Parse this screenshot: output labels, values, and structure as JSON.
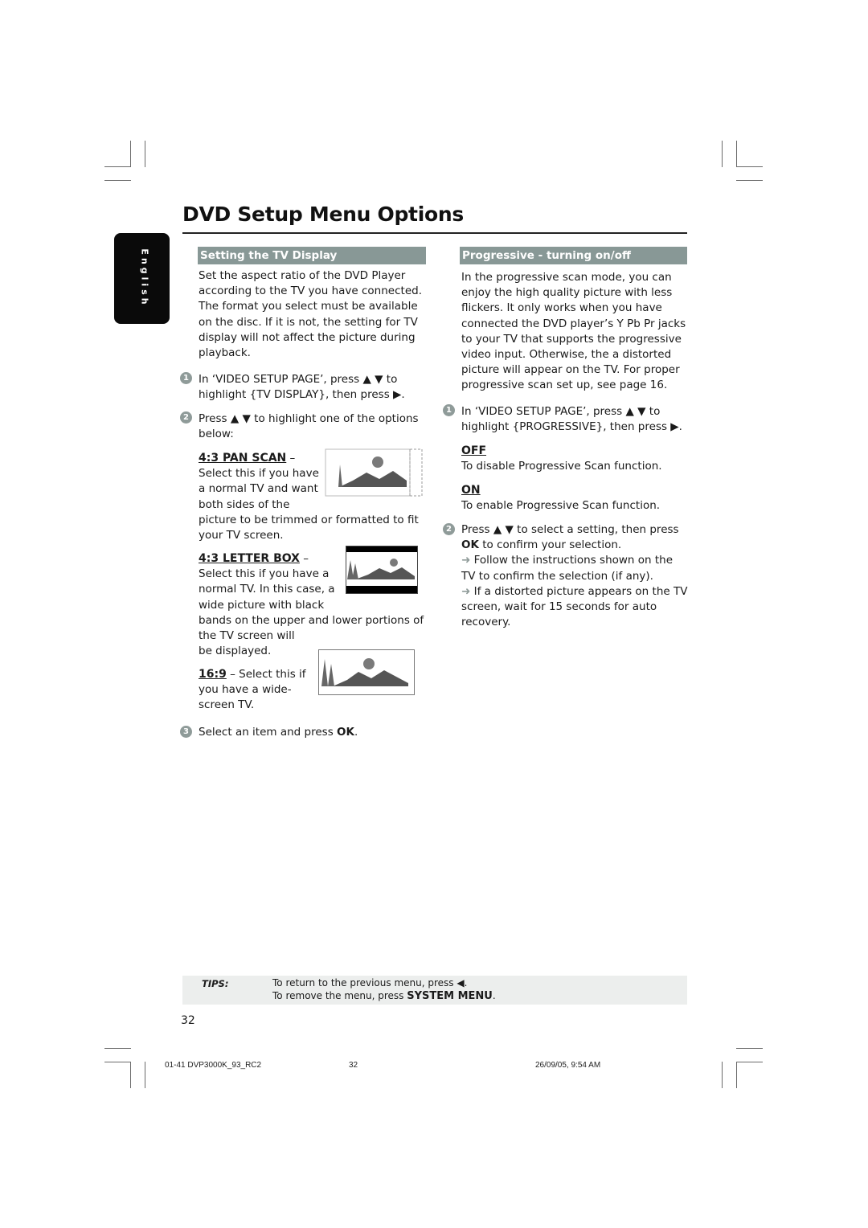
{
  "page": {
    "title": "DVD Setup Menu Options",
    "language_tab": "English",
    "page_number": "32"
  },
  "left_section": {
    "heading": "Setting the TV Display",
    "intro_lines": [
      "Set the aspect ratio of the DVD Player",
      "according to the TV you have connected.",
      "The format you select must be available",
      "on the disc.  If it is not, the setting for TV",
      "display will not affect the picture during",
      "playback."
    ],
    "steps": [
      {
        "number": "1",
        "lines": [
          "In ‘VIDEO SETUP PAGE’, press ▲ ▼ to",
          "highlight {TV DISPLAY}, then press ▶."
        ]
      },
      {
        "number": "2",
        "lines": [
          "Press ▲ ▼ to highlight one of the options",
          "below:"
        ]
      },
      {
        "number": "3",
        "text_before": "Select an item and press ",
        "bold": "OK",
        "text_after": "."
      }
    ],
    "options": [
      {
        "name": "4:3 PAN SCAN",
        "dash": " –",
        "lines": [
          "Select this if you have",
          "a normal TV and want",
          "both sides of the",
          "picture to be trimmed or formatted to fit",
          "your TV screen."
        ],
        "image": "pan-scan-illustration"
      },
      {
        "name": "4:3 LETTER BOX",
        "dash": " –",
        "lines": [
          "Select this if you have a",
          "normal TV. In this case, a",
          "wide picture with black",
          "bands on the upper and lower portions of",
          "the TV screen will",
          "be displayed."
        ],
        "image": "letterbox-illustration"
      },
      {
        "name": "16:9",
        "dash": " – Select this if",
        "lines": [
          "you have a wide-",
          "screen TV."
        ],
        "image": "widescreen-illustration"
      }
    ]
  },
  "right_section": {
    "heading": "Progressive - turning on/off",
    "intro_lines": [
      "In the progressive scan mode, you can",
      "enjoy the high quality picture with less",
      "flickers.  It only works when you have",
      "connected the DVD player’s Y Pb Pr jacks",
      "to your TV that supports the progressive",
      "video input.  Otherwise, the a distorted",
      "picture will appear on the TV.  For proper",
      "progressive scan set up, see page 16."
    ],
    "step1": {
      "number": "1",
      "lines": [
        "In ‘VIDEO SETUP PAGE’, press ▲ ▼ to",
        "highlight {PROGRESSIVE}, then press ▶."
      ]
    },
    "settings": [
      {
        "name": "OFF",
        "description": "To disable Progressive Scan function."
      },
      {
        "name": "ON",
        "description": "To enable Progressive Scan function."
      }
    ],
    "step2": {
      "number": "2",
      "line1": "Press ▲ ▼ to select a setting, then press",
      "line2_bold": "OK",
      "line2_rest": " to confirm your selection.",
      "notes": [
        {
          "arrow": "➜",
          "lines": [
            " Follow the instructions shown on the",
            "TV to confirm the selection (if any)."
          ]
        },
        {
          "arrow": "➜",
          "lines": [
            " If a distorted picture appears on the TV",
            "screen, wait for 15 seconds for auto",
            "recovery."
          ]
        }
      ]
    }
  },
  "tips": {
    "label": "TIPS:",
    "line1": "To return to the previous menu, press ◀.",
    "line2_prefix": "To remove the menu, press ",
    "line2_bold": "SYSTEM MENU",
    "line2_suffix": "."
  },
  "print_footer": {
    "file": "01-41 DVP3000K_93_RC2",
    "page": "32",
    "timestamp": "26/09/05, 9:54 AM"
  },
  "colors": {
    "section_heading_bg": "#889896",
    "step_badge": "#8f9b99",
    "tips_bg": "#eceeed",
    "language_tab_bg": "#0a0a0a"
  }
}
